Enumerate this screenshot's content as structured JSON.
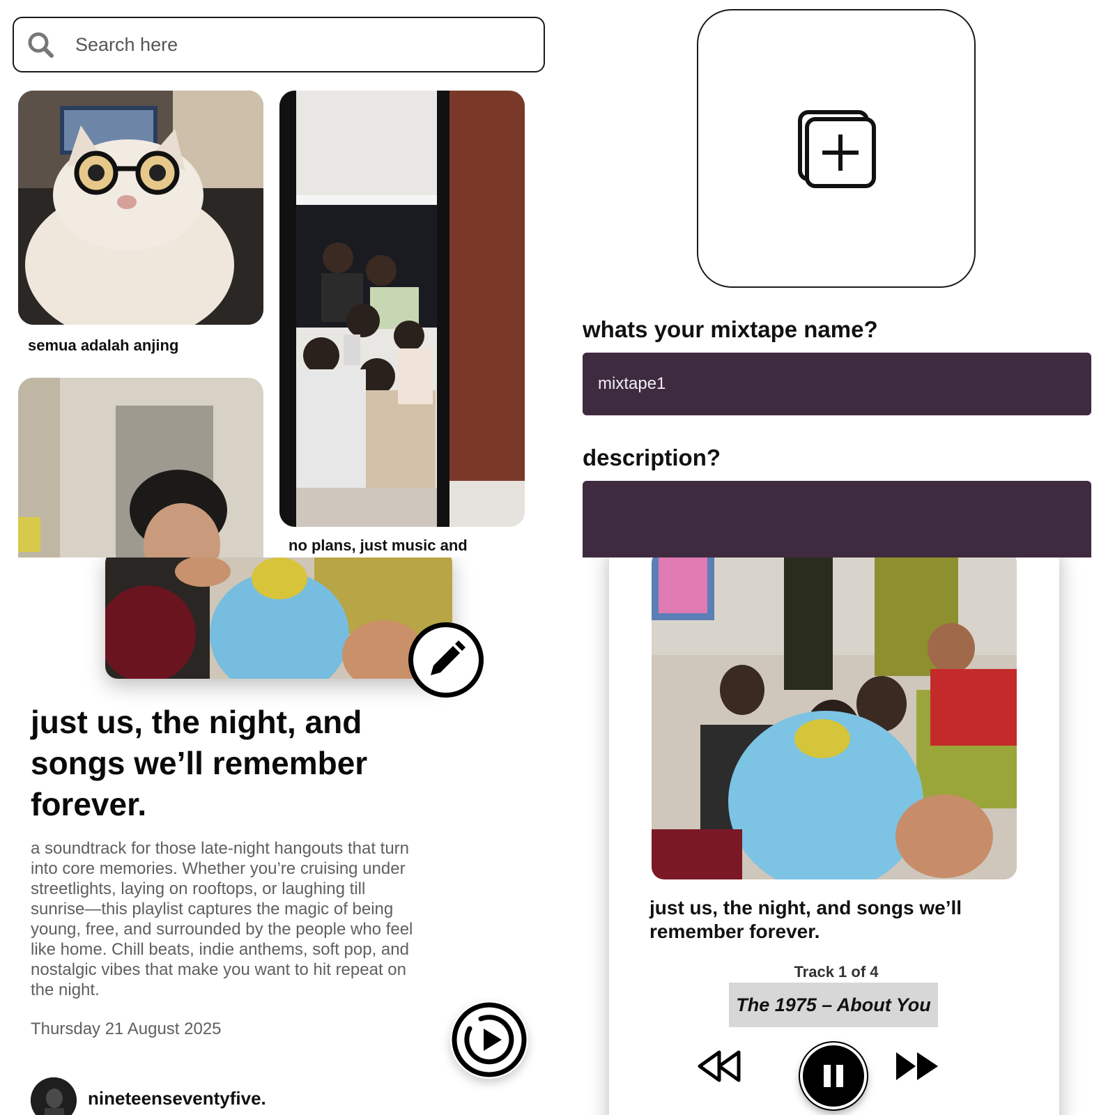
{
  "search": {
    "placeholder": "Search here"
  },
  "feed": {
    "items": [
      {
        "caption": "semua adalah anjing"
      },
      {
        "caption": "no plans, just music and"
      },
      {
        "caption": ""
      }
    ]
  },
  "create": {
    "name_label": "whats your mixtape name?",
    "name_value": "mixtape1",
    "description_label": "description?",
    "description_value": ""
  },
  "detail": {
    "title": "just us, the night, and songs we’ll remember forever.",
    "description": "a soundtrack for those late-night hangouts that turn into core memories. Whether you’re cruising under streetlights, laying on rooftops, or laughing till sunrise—this playlist captures the magic of being young, free, and surrounded by the people who feel like home. Chill beats, indie anthems, soft pop, and nostalgic vibes that make you want to hit repeat on the night.",
    "date": "Thursday 21 August 2025",
    "username": "nineteenseventyfive."
  },
  "player": {
    "title": "just us, the night, and songs we’ll remember forever.",
    "track_counter": "Track 1 of 4",
    "track_name": "The 1975 – About You",
    "state": "playing"
  },
  "icons": {
    "search": "search-icon",
    "add_cover": "add-image-icon",
    "edit": "pencil-icon",
    "play": "play-icon",
    "rewind": "rewind-icon",
    "pause": "pause-icon",
    "fast_forward": "fast-forward-icon"
  },
  "colors": {
    "input_fill": "#3f2b40",
    "input_text": "#f2eef3",
    "track_highlight": "#d7d7d7"
  }
}
